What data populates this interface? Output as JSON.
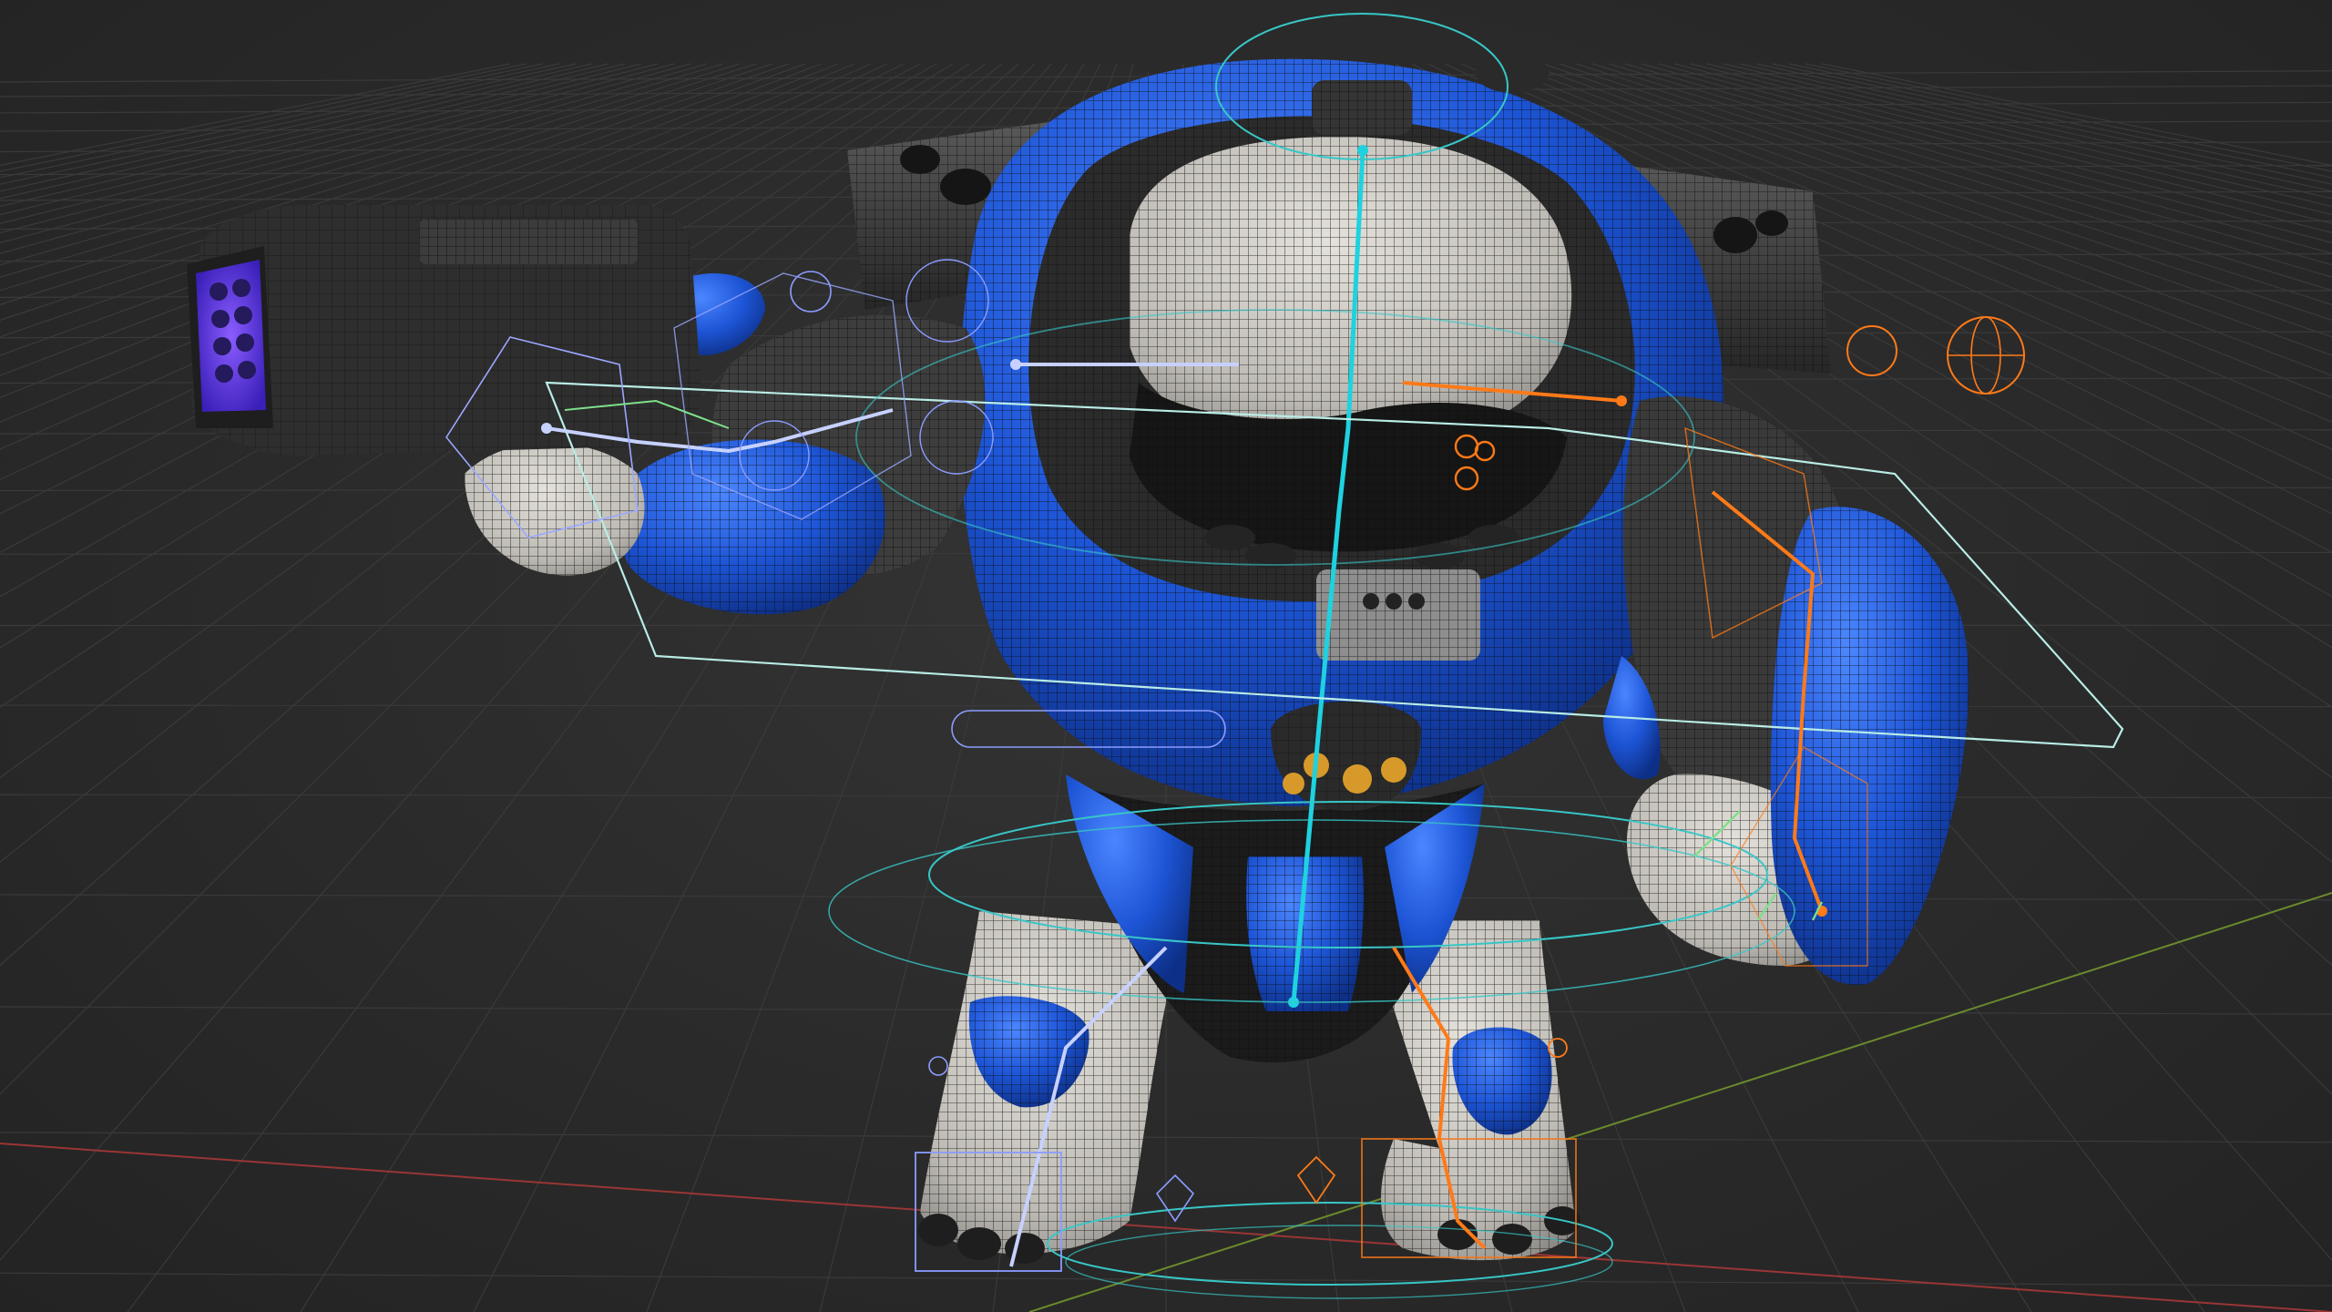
{
  "viewport": {
    "background": "#2b2b2b",
    "grid_color": "#3a3a3a",
    "x_axis_color": "#9a3535",
    "y_axis_color": "#6b8a2c"
  },
  "model": {
    "armor_color": "#1f56d8",
    "armor_highlight": "#3f7bff",
    "metal_color": "#3a3a3a",
    "skin_color": "#cdcac4",
    "visor_glow_color": "#6b3cff",
    "wire_color": "#0d0d0d"
  },
  "rig": {
    "center_bone_color": "#1ed2e0",
    "left_bone_color": "#c7d1ff",
    "right_bone_color": "#ff7a18",
    "control_shape_color": "#38c6c6",
    "outline_color": "#b9ece6"
  },
  "icons": [
    "viewport-grid",
    "robot-character-model",
    "armature-rig",
    "root-control-icon",
    "ik-target-icon"
  ]
}
